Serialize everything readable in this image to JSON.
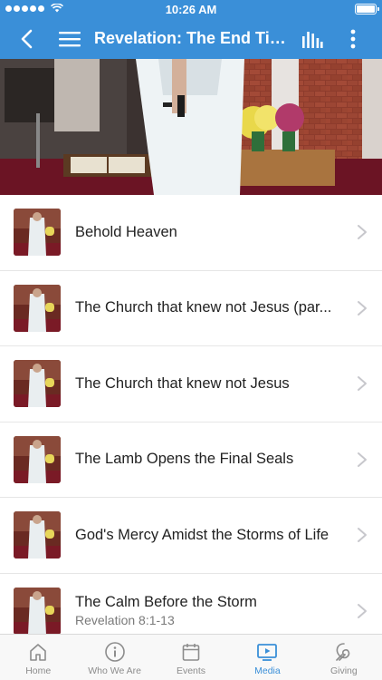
{
  "status_bar": {
    "time": "10:26 AM"
  },
  "app_bar": {
    "title": "Revelation: The End Tim..."
  },
  "sermons": [
    {
      "title": "Behold Heaven",
      "subtitle": ""
    },
    {
      "title": "The Church that knew not Jesus (par...",
      "subtitle": ""
    },
    {
      "title": "The Church that knew not Jesus",
      "subtitle": ""
    },
    {
      "title": "The Lamb Opens the Final Seals",
      "subtitle": ""
    },
    {
      "title": "God's Mercy Amidst the Storms of Life",
      "subtitle": ""
    },
    {
      "title": "The Calm Before the Storm",
      "subtitle": "Revelation 8:1-13"
    }
  ],
  "tabs": [
    {
      "label": "Home",
      "icon": "home-icon"
    },
    {
      "label": "Who We Are",
      "icon": "info-icon"
    },
    {
      "label": "Events",
      "icon": "calendar-icon"
    },
    {
      "label": "Media",
      "icon": "play-icon",
      "active": true
    },
    {
      "label": "Giving",
      "icon": "giving-icon"
    }
  ],
  "colors": {
    "accent": "#3a8fd8",
    "tab_inactive": "#8c8c8c"
  }
}
